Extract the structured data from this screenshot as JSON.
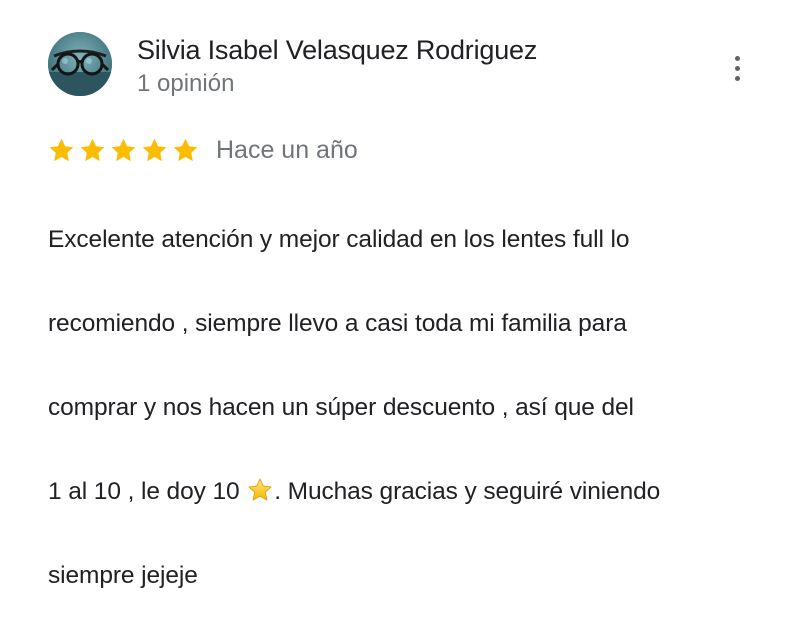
{
  "review": {
    "author_name": "Silvia Isabel Velasquez Rodriguez",
    "author_meta": "1 opinión",
    "rating": 5,
    "rating_max": 5,
    "date": "Hace un año",
    "text_lines": [
      "Excelente atención y mejor calidad en los lentes full lo",
      "recomiendo , siempre llevo a casi toda mi familia para",
      "comprar y nos hacen un súper descuento , así que del"
    ],
    "text_line4_before_emoji": "1 al 10 , le doy 10 ",
    "text_line4_after_emoji": ". Muchas gracias y seguiré viniendo",
    "text_line5": "siempre jejeje"
  },
  "icons": {
    "avatar": "avatar-photo-glasses",
    "more": "more-vert-icon",
    "star": "star-icon",
    "emoji": "star-emoji-icon"
  },
  "colors": {
    "star": "#fbbc04",
    "name": "#202124",
    "secondary": "#70757a",
    "body": "#202124"
  }
}
